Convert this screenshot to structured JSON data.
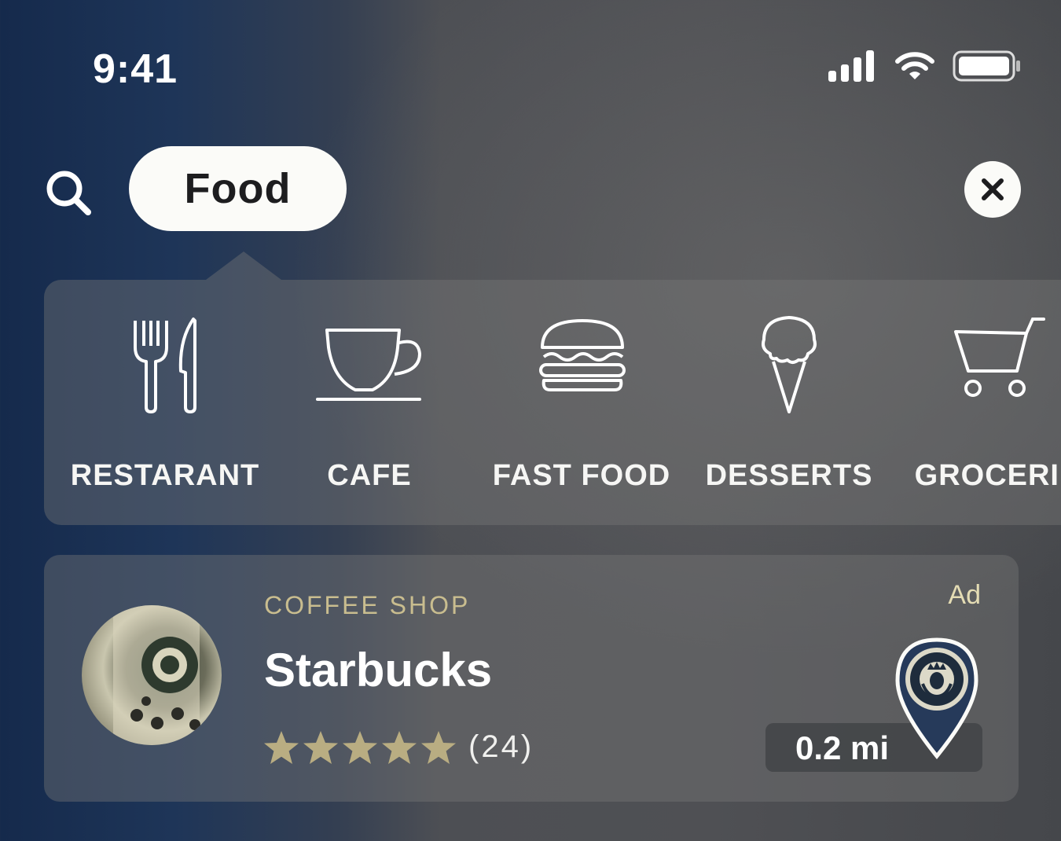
{
  "status_bar": {
    "time": "9:41"
  },
  "search": {
    "chip_label": "Food"
  },
  "categories": [
    {
      "label": "RESTARANT",
      "icon": "fork-knife-icon"
    },
    {
      "label": "CAFE",
      "icon": "coffee-cup-icon"
    },
    {
      "label": "FAST FOOD",
      "icon": "burger-icon"
    },
    {
      "label": "DESSERTS",
      "icon": "ice-cream-icon"
    },
    {
      "label": "GROCERIE",
      "icon": "shopping-cart-icon"
    }
  ],
  "result": {
    "category": "COFFEE SHOP",
    "name": "Starbucks",
    "rating": 5,
    "review_count": "(24)",
    "ad_label": "Ad",
    "distance": "0.2 mi"
  },
  "colors": {
    "accent_gold": "#c9bd8f",
    "star_color": "#b9ad82"
  }
}
